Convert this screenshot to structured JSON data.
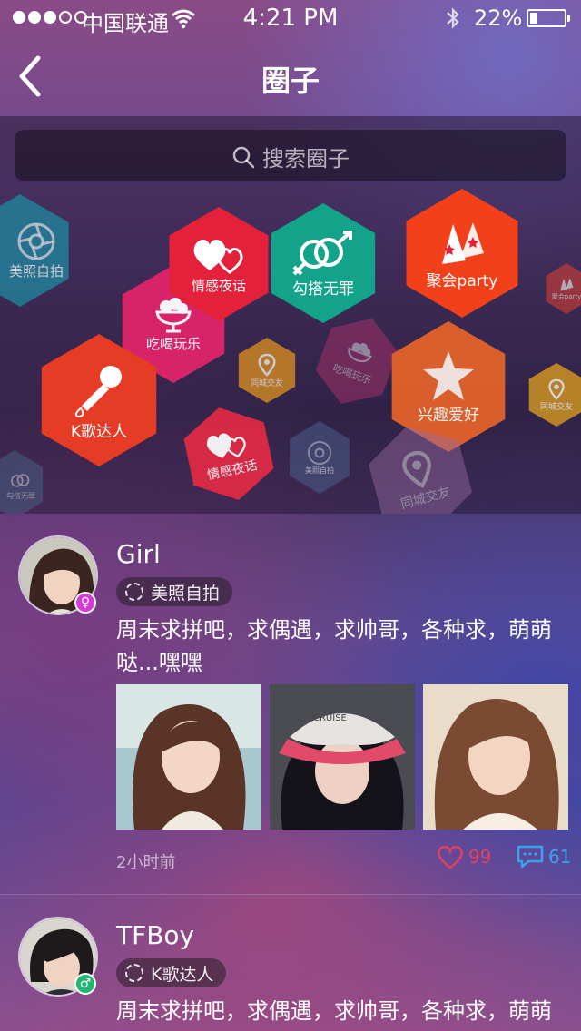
{
  "status_bar": {
    "carrier": "中国联通",
    "time": "4:21 PM",
    "battery_pct": "22%",
    "battery_level": 0.22,
    "signal_bars": 3,
    "signal_total": 5
  },
  "nav": {
    "title": "圈子",
    "back_icon": "chevron-left-icon"
  },
  "search": {
    "placeholder": "搜索圈子",
    "icon": "search-icon"
  },
  "categories": [
    {
      "id": "selfie-left",
      "label": "美照自拍",
      "icon": "camera-aperture-icon",
      "color": "#1f8aa0"
    },
    {
      "id": "romance-main",
      "label": "情感夜话",
      "icon": "hearts-icon",
      "color": "#e3213a"
    },
    {
      "id": "flirt-main",
      "label": "勾搭无罪",
      "icon": "gender-rings-icon",
      "color": "#12a38a"
    },
    {
      "id": "party-main",
      "label": "聚会party",
      "icon": "party-hat-icon",
      "color": "#f2401b"
    },
    {
      "id": "food-main",
      "label": "吃喝玩乐",
      "icon": "ice-cream-icon",
      "color": "#e0246b"
    },
    {
      "id": "ktv-main",
      "label": "K歌达人",
      "icon": "microphone-icon",
      "color": "#e63b24"
    },
    {
      "id": "local-small",
      "label": "同城交友",
      "icon": "location-pin-icon",
      "color": "#e0921f"
    },
    {
      "id": "food-faded",
      "label": "吃喝玩乐",
      "icon": "ice-cream-icon",
      "color": "#b8336f"
    },
    {
      "id": "hobby-main",
      "label": "兴趣爱好",
      "icon": "star-icon",
      "color": "#e8642a"
    },
    {
      "id": "local-right",
      "label": "同城交友",
      "icon": "location-pin-icon",
      "color": "#d99a20"
    },
    {
      "id": "party-right",
      "label": "聚会party",
      "icon": "party-hat-icon",
      "color": "#d63e33"
    },
    {
      "id": "romance-2",
      "label": "情感夜话",
      "icon": "hearts-icon",
      "color": "#e32a45"
    },
    {
      "id": "selfie-faded",
      "label": "美照自拍",
      "icon": "camera-aperture-icon",
      "color": "#4a5a86"
    },
    {
      "id": "local-faded",
      "label": "同城交友",
      "icon": "location-pin-icon",
      "color": "#9a6aa0"
    },
    {
      "id": "flirt-faded",
      "label": "勾搭无罪",
      "icon": "gender-rings-icon",
      "color": "#4a6a8a"
    }
  ],
  "posts": [
    {
      "username": "Girl",
      "gender": "female",
      "gender_icon": "female-symbol-icon",
      "gender_color": "#d63ad6",
      "circle": "美照自拍",
      "text": "周末求拼吧，求偶遇，求帅哥，各种求，萌萌哒...嘿嘿",
      "time": "2小时前",
      "likes": "99",
      "comments": "61"
    },
    {
      "username": "TFBoy",
      "gender": "male",
      "gender_icon": "male-symbol-icon",
      "gender_color": "#22b573",
      "circle": "K歌达人",
      "text": "周末求拼吧，求偶遇，求帅哥，各种求，萌萌哒...嘿嘿"
    }
  ]
}
